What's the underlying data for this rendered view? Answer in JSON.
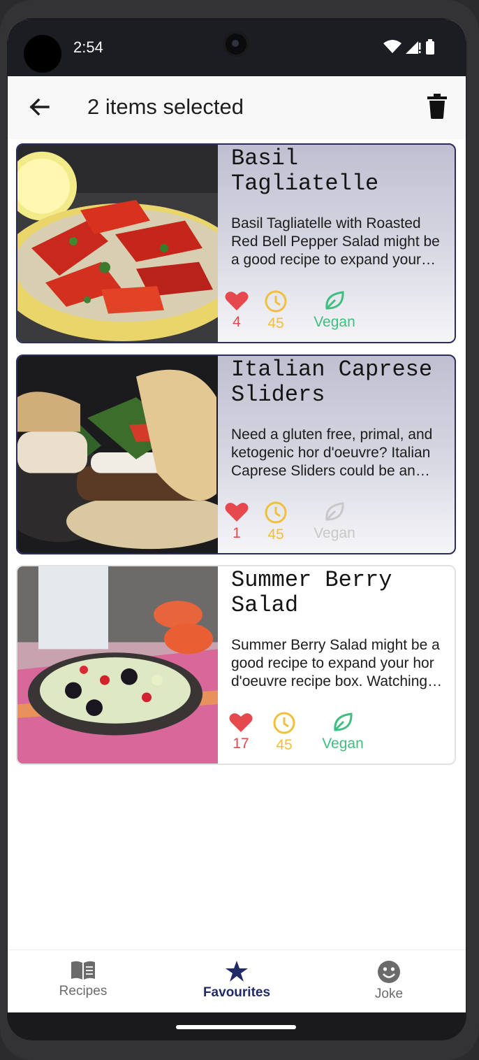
{
  "status": {
    "time": "2:54"
  },
  "appbar": {
    "title": "2 items selected"
  },
  "recipes": [
    {
      "title": "Basil Tagliatelle",
      "description": "Basil Tagliatelle with Roasted Red Bell Pepper Salad might be a good recipe to expand your hor d'oeuvre recipe box.",
      "likes": "4",
      "time": "45",
      "vegan_label": "Vegan",
      "vegan": true,
      "selected": true
    },
    {
      "title": "Italian Caprese Sliders",
      "description": "Need a gluten free, primal, and ketogenic hor d'oeuvre? Italian Caprese Sliders could be an amazing recipe to try.",
      "likes": "1",
      "time": "45",
      "vegan_label": "Vegan",
      "vegan": false,
      "selected": true
    },
    {
      "title": "Summer Berry Salad",
      "description": "Summer Berry Salad might be a good recipe to expand your hor d'oeuvre recipe box. Watching your figure?",
      "likes": "17",
      "time": "45",
      "vegan_label": "Vegan",
      "vegan": true,
      "selected": false
    }
  ],
  "bottom_nav": {
    "recipes": "Recipes",
    "favourites": "Favourites",
    "joke": "Joke",
    "active": "favourites"
  },
  "colors": {
    "heart": "#e5484d",
    "clock": "#f0bf3c",
    "vegan_active": "#3fbf7f",
    "vegan_inactive": "#c8c8c8",
    "nav_active": "#1f2a66",
    "nav_inactive": "#6b6b6b"
  }
}
